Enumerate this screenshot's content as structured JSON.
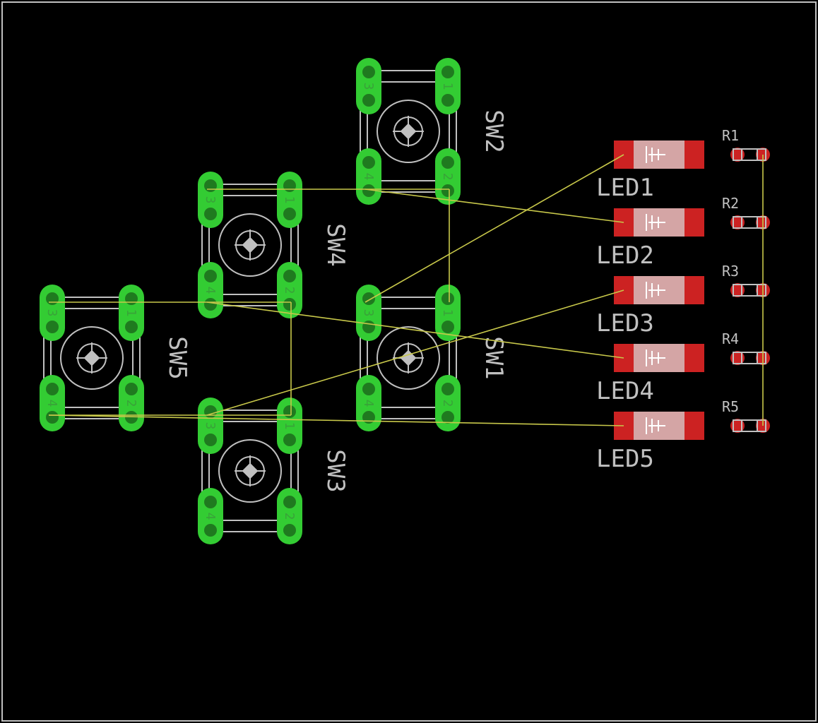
{
  "colors": {
    "background": "#000000",
    "board_outline": "#c0c0c0",
    "silkscreen": "#c0c0c0",
    "pad_green": "#33cc33",
    "pad_red": "#cc2222",
    "airwire": "#c8c84a"
  },
  "switches": [
    {
      "id": "sw1",
      "label": "SW1",
      "pins": [
        "3",
        "1",
        "4",
        "2"
      ]
    },
    {
      "id": "sw2",
      "label": "SW2",
      "pins": [
        "3",
        "1",
        "4",
        "2"
      ]
    },
    {
      "id": "sw3",
      "label": "SW3",
      "pins": [
        "3",
        "1",
        "4",
        "2"
      ]
    },
    {
      "id": "sw4",
      "label": "SW4",
      "pins": [
        "3",
        "1",
        "4",
        "2"
      ]
    },
    {
      "id": "sw5",
      "label": "SW5",
      "pins": [
        "3",
        "1",
        "4",
        "2"
      ]
    }
  ],
  "leds": [
    {
      "id": "led1",
      "label": "LED1"
    },
    {
      "id": "led2",
      "label": "LED2"
    },
    {
      "id": "led3",
      "label": "LED3"
    },
    {
      "id": "led4",
      "label": "LED4"
    },
    {
      "id": "led5",
      "label": "LED5"
    }
  ],
  "resistors": [
    {
      "id": "r1",
      "label": "R1"
    },
    {
      "id": "r2",
      "label": "R2"
    },
    {
      "id": "r3",
      "label": "R3"
    },
    {
      "id": "r4",
      "label": "R4"
    },
    {
      "id": "r5",
      "label": "R5"
    }
  ]
}
